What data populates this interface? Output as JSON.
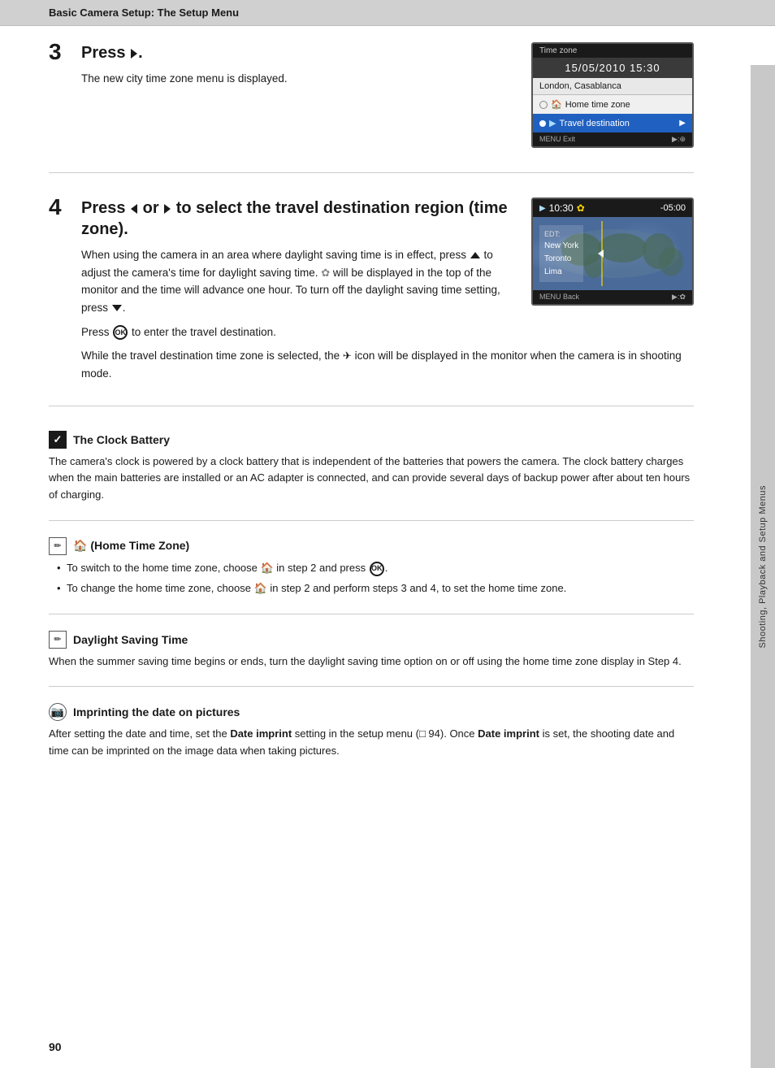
{
  "header": {
    "title": "Basic Camera Setup: The Setup Menu"
  },
  "sidebar": {
    "label": "Shooting, Playback and Setup Menus"
  },
  "page_number": "90",
  "step3": {
    "number": "3",
    "title_pre": "Press ",
    "title_arrow": "▶",
    "title_post": ".",
    "description": "The new city time zone menu is displayed.",
    "screen": {
      "header": "Time zone",
      "time": "15/05/2010  15:30",
      "city": "London, Casablanca",
      "option1": "Home time zone",
      "option2": "Travel destination",
      "footer_left": "MENU Exit",
      "footer_right": "▶:⊕"
    }
  },
  "step4": {
    "number": "4",
    "title": "Press ◀ or ▶ to select the travel destination region (time zone).",
    "description1": "When using the camera in an area where daylight saving time is in effect, press ▲ to adjust the camera's time for daylight saving time. ✿ will be displayed in the top of the monitor and the time will advance one hour. To turn off the daylight saving time setting, press ▼.",
    "description2": "Press OK to enter the travel destination.",
    "description3": "While the travel destination time zone is selected, the ✈ icon will be displayed in the monitor when the camera is in shooting mode.",
    "screen": {
      "header_time": "10:30",
      "header_icon": "✿",
      "header_offset": "-05:00",
      "label": "EDT:",
      "cities": "New York\nToronto\nLima",
      "footer_left": "MENU Back",
      "footer_right": "▶:✿"
    }
  },
  "note_clock": {
    "icon": "✓",
    "title": "The Clock Battery",
    "body": "The camera's clock is powered by a clock battery that is independent of the batteries that powers the camera. The clock battery charges when the main batteries are installed or an AC adapter is connected, and can provide several days of backup power after about ten hours of charging."
  },
  "note_home": {
    "icon": "✏",
    "title": "🏠 (Home Time Zone)",
    "bullet1_pre": "To switch to the home time zone, choose ",
    "bullet1_home": "🏠",
    "bullet1_post": " in step 2 and press OK.",
    "bullet2_pre": "To change the home time zone, choose ",
    "bullet2_home": "🏠",
    "bullet2_post": " in step 2 and perform steps 3 and 4, to set the home time zone."
  },
  "note_daylight": {
    "icon": "✏",
    "title": "Daylight Saving Time",
    "body": "When the summer saving time begins or ends, turn the daylight saving time option on or off using the home time zone display in Step 4."
  },
  "note_imprint": {
    "icon": "☀",
    "title": "Imprinting the date on pictures",
    "body_pre": "After setting the date and time, set the ",
    "bold1": "Date imprint",
    "body_mid1": " setting in the setup menu (□ 94). Once ",
    "bold2": "Date imprint",
    "body_mid2": " is set, the shooting date and time can be imprinted on the image data when taking pictures."
  }
}
